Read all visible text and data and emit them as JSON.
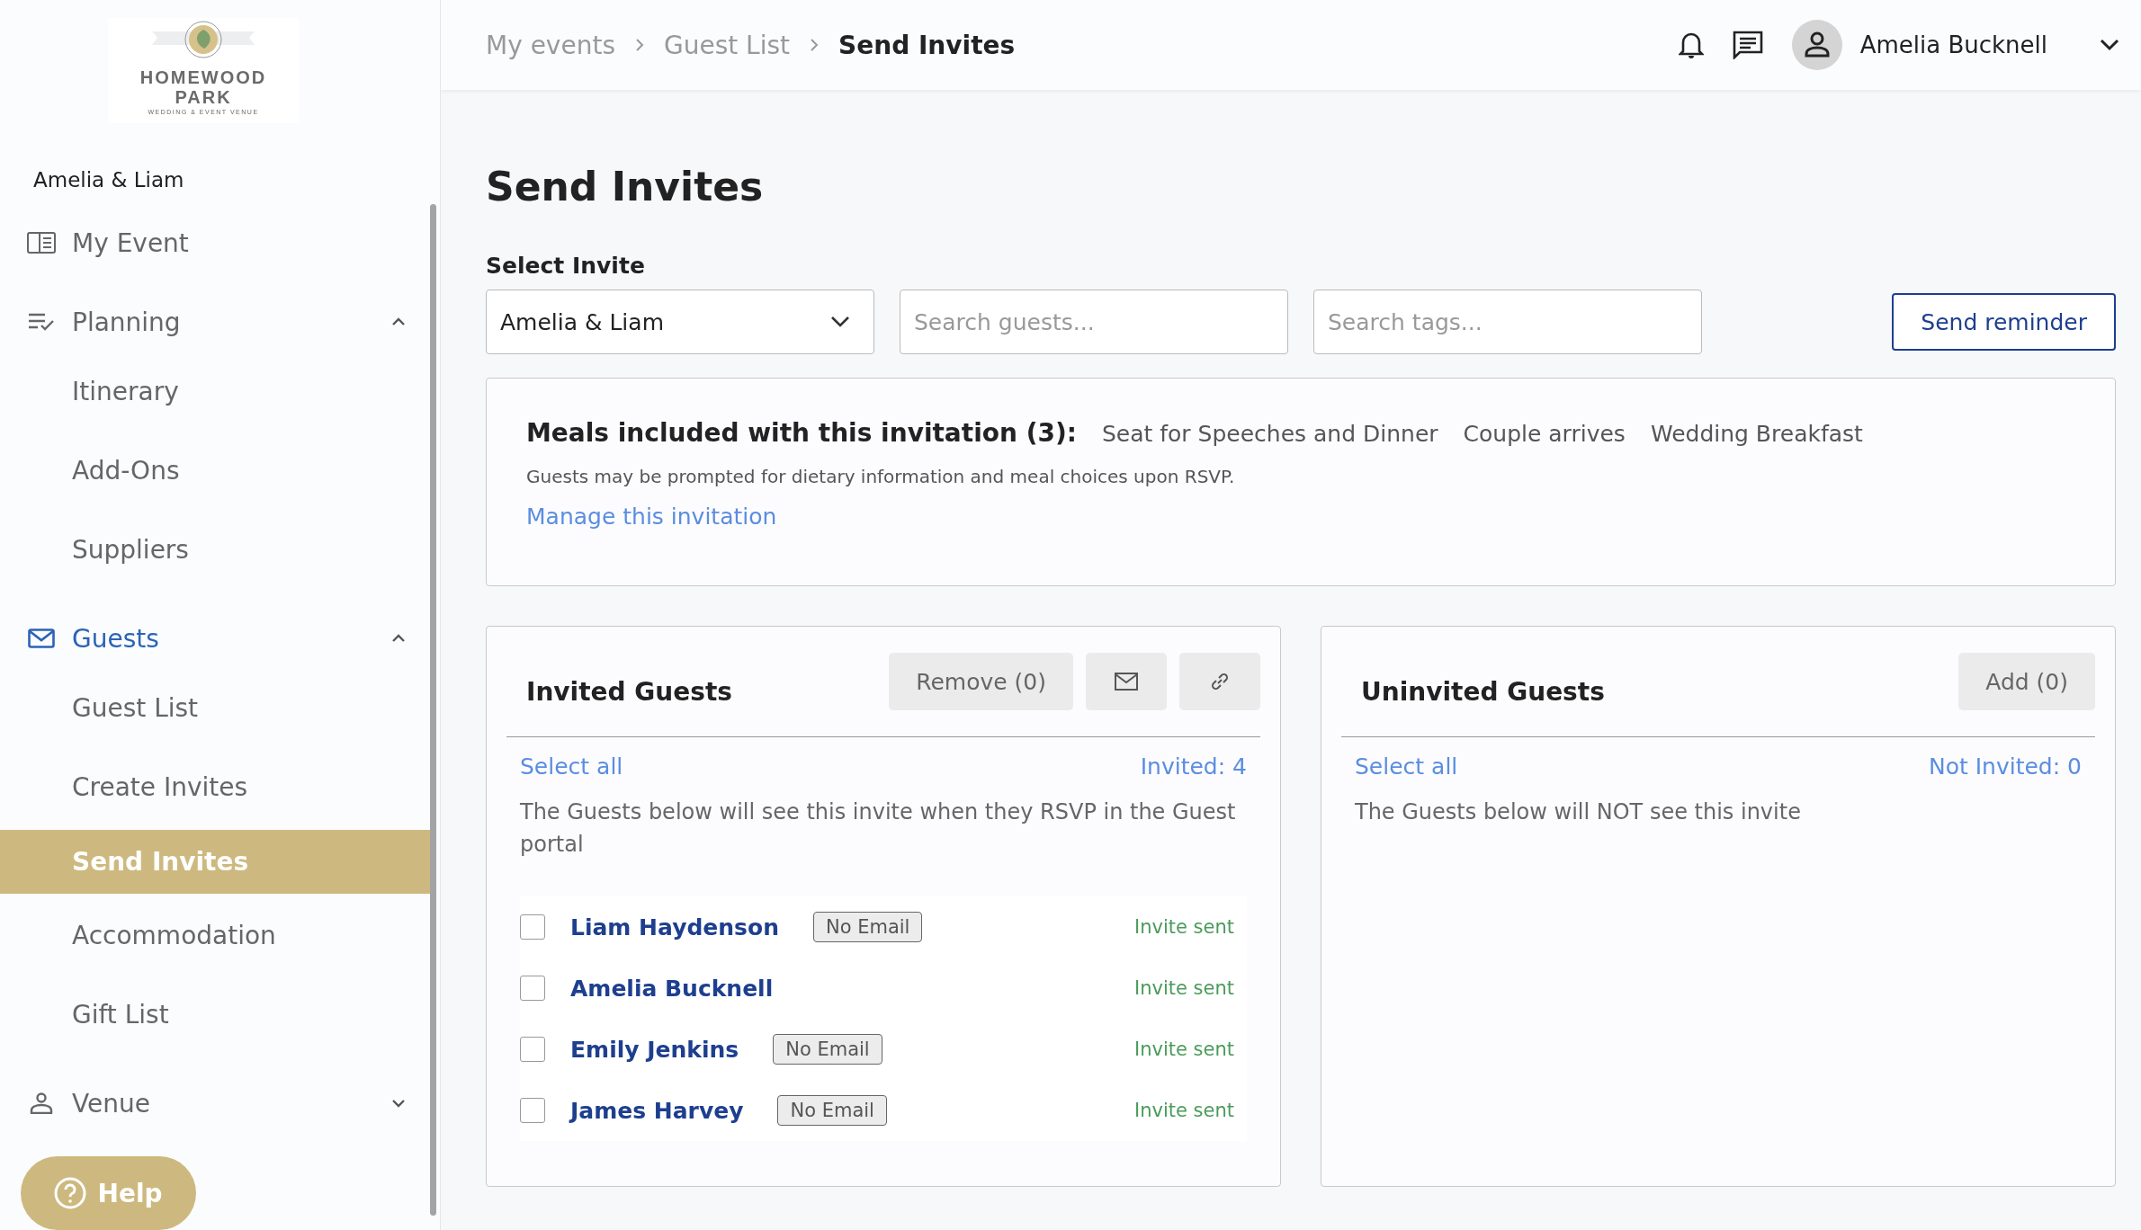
{
  "sidebar": {
    "logo": {
      "title_lines": [
        "HOMEWOOD",
        "PARK"
      ],
      "tagline": "WEDDING & EVENT VENUE"
    },
    "event_name": "Amelia & Liam",
    "nav": [
      {
        "label": "My Event",
        "kind": "item"
      },
      {
        "label": "Planning",
        "kind": "group",
        "expanded": true,
        "active": false,
        "children": [
          {
            "label": "Itinerary",
            "selected": false
          },
          {
            "label": "Add-Ons",
            "selected": false
          },
          {
            "label": "Suppliers",
            "selected": false
          }
        ]
      },
      {
        "label": "Guests",
        "kind": "group",
        "expanded": true,
        "active": true,
        "children": [
          {
            "label": "Guest List",
            "selected": false
          },
          {
            "label": "Create Invites",
            "selected": false
          },
          {
            "label": "Send Invites",
            "selected": true
          },
          {
            "label": "Accommodation",
            "selected": false
          },
          {
            "label": "Gift List",
            "selected": false
          }
        ]
      },
      {
        "label": "Venue",
        "kind": "group",
        "expanded": false,
        "active": false
      }
    ],
    "help_button": "Help"
  },
  "header": {
    "breadcrumbs": [
      {
        "label": "My events",
        "current": false
      },
      {
        "label": "Guest List",
        "current": false
      },
      {
        "label": "Send Invites",
        "current": true
      }
    ],
    "user_name": "Amelia Bucknell"
  },
  "page": {
    "title": "Send Invites",
    "select_label": "Select Invite",
    "select_value": "Amelia & Liam",
    "search_guests": {
      "placeholder": "Search guests..."
    },
    "search_tags": {
      "placeholder": "Search tags..."
    },
    "reminder_button": "Send reminder"
  },
  "meals": {
    "heading": "Meals included with this invitation (3):",
    "items": [
      "Seat for Speeches and Dinner",
      "Couple arrives",
      "Wedding Breakfast"
    ],
    "hint": "Guests may be prompted for dietary information and meal choices upon RSVP.",
    "link": "Manage this invitation"
  },
  "invited": {
    "title": "Invited Guests",
    "remove_button": "Remove (0)",
    "select_all": "Select all",
    "count": "Invited: 4",
    "description": "The Guests below will see this invite when they RSVP in the Guest portal",
    "guests": [
      {
        "name": "Liam Haydenson",
        "badge": "No Email",
        "status": "Invite sent",
        "checked": false
      },
      {
        "name": "Amelia Bucknell",
        "status": "Invite sent",
        "checked": false
      },
      {
        "name": "Emily Jenkins",
        "badge": "No Email",
        "status": "Invite sent",
        "checked": false
      },
      {
        "name": "James Harvey",
        "badge": "No Email",
        "status": "Invite sent",
        "checked": false
      }
    ]
  },
  "uninvited": {
    "title": "Uninvited Guests",
    "add_button": "Add (0)",
    "select_all": "Select all",
    "count": "Not Invited: 0",
    "description": "The Guests below will NOT see this invite"
  }
}
